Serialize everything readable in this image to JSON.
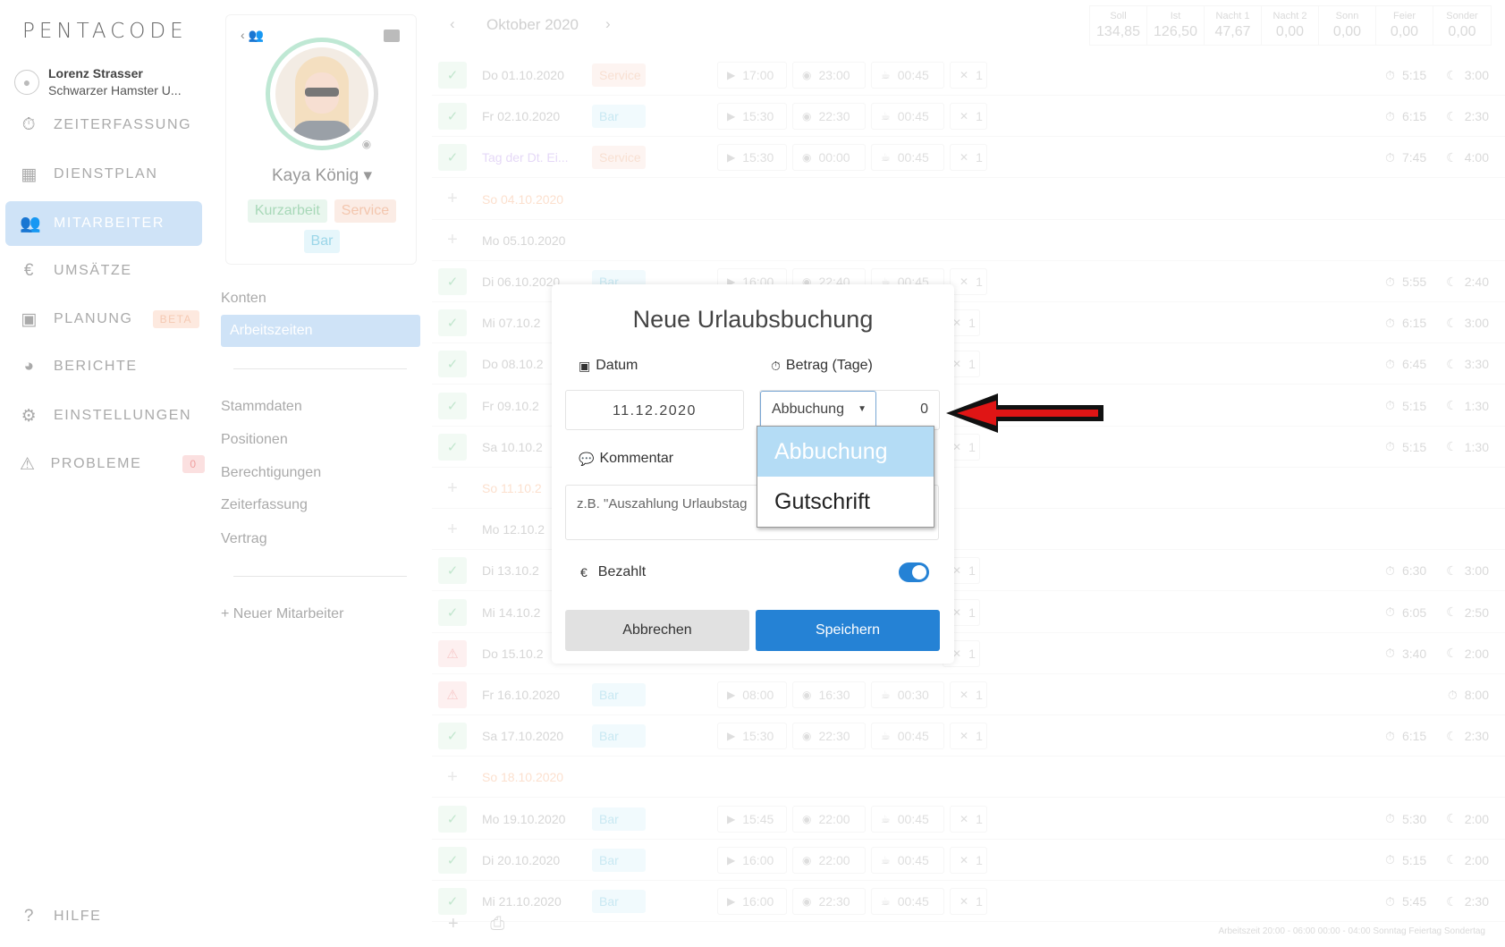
{
  "logo": "PENTACODE",
  "user": {
    "name": "Lorenz Strasser",
    "company": "Schwarzer Hamster U..."
  },
  "nav": {
    "items": [
      {
        "label": "ZEITERFASSUNG"
      },
      {
        "label": "DIENSTPLAN"
      },
      {
        "label": "MITARBEITER"
      },
      {
        "label": "UMSÄTZE"
      },
      {
        "label": "PLANUNG",
        "badge": "BETA"
      },
      {
        "label": "BERICHTE"
      },
      {
        "label": "EINSTELLUNGEN"
      },
      {
        "label": "PROBLEME",
        "count": "0"
      }
    ],
    "help": "HILFE"
  },
  "profile": {
    "name": "Kaya König",
    "tags": [
      "Kurzarbeit",
      "Service",
      "Bar"
    ]
  },
  "submenu": {
    "items": [
      "Konten",
      "Arbeitszeiten"
    ],
    "items2": [
      "Stammdaten",
      "Positionen",
      "Berechtigungen",
      "Zeiterfassung",
      "Vertrag"
    ],
    "new_employee": "Neuer Mitarbeiter"
  },
  "calendar": {
    "month": "Oktober 2020",
    "stats": [
      {
        "k": "Soll",
        "v": "134,85"
      },
      {
        "k": "Ist",
        "v": "126,50"
      },
      {
        "k": "Nacht 1",
        "v": "47,67"
      },
      {
        "k": "Nacht 2",
        "v": "0,00"
      },
      {
        "k": "Sonn",
        "v": "0,00"
      },
      {
        "k": "Feier",
        "v": "0,00"
      },
      {
        "k": "Sonder",
        "v": "0,00"
      }
    ],
    "rows": [
      {
        "date": "Do 01.10.2020",
        "pos": "Service",
        "start": "17:00",
        "end": "23:00",
        "pause": "00:45",
        "meal": "1",
        "work": "5:15",
        "night": "3:00"
      },
      {
        "date": "Fr 02.10.2020",
        "pos": "Bar",
        "start": "15:30",
        "end": "22:30",
        "pause": "00:45",
        "meal": "1",
        "work": "6:15",
        "night": "2:30"
      },
      {
        "date": "Tag der Dt. Ei...",
        "pos": "Service",
        "start": "15:30",
        "end": "00:00",
        "pause": "00:45",
        "meal": "1",
        "work": "7:45",
        "night": "4:00"
      },
      {
        "date": "So 04.10.2020"
      },
      {
        "date": "Mo 05.10.2020"
      },
      {
        "date": "Di 06.10.2020",
        "pos": "Bar",
        "start": "16:00",
        "end": "22:40",
        "pause": "00:45",
        "meal": "1",
        "work": "5:55",
        "night": "2:40"
      },
      {
        "date": "Mi 07.10.2",
        "meal": "1",
        "work": "6:15",
        "night": "3:00"
      },
      {
        "date": "Do 08.10.2",
        "meal": "1",
        "work": "6:45",
        "night": "3:30"
      },
      {
        "date": "Fr 09.10.2",
        "work": "5:15",
        "night": "1:30"
      },
      {
        "date": "Sa 10.10.2",
        "meal": "1",
        "work": "5:15",
        "night": "1:30"
      },
      {
        "date": "So 11.10.2"
      },
      {
        "date": "Mo 12.10.2"
      },
      {
        "date": "Di 13.10.2",
        "meal": "1",
        "work": "6:30",
        "night": "3:00"
      },
      {
        "date": "Mi 14.10.2",
        "meal": "1",
        "work": "6:05",
        "night": "2:50"
      },
      {
        "date": "Do 15.10.2",
        "meal": "1",
        "work": "3:40",
        "night": "2:00"
      },
      {
        "date": "Fr 16.10.2020",
        "pos": "Bar",
        "start": "08:00",
        "end": "16:30",
        "pause": "00:30",
        "meal": "1",
        "work": "8:00"
      },
      {
        "date": "Sa 17.10.2020",
        "pos": "Bar",
        "start": "15:30",
        "end": "22:30",
        "pause": "00:45",
        "meal": "1",
        "work": "6:15",
        "night": "2:30"
      },
      {
        "date": "So 18.10.2020"
      },
      {
        "date": "Mo 19.10.2020",
        "pos": "Bar",
        "start": "15:45",
        "end": "22:00",
        "pause": "00:45",
        "meal": "1",
        "work": "5:30",
        "night": "2:00"
      },
      {
        "date": "Di 20.10.2020",
        "pos": "Bar",
        "start": "16:00",
        "end": "22:00",
        "pause": "00:45",
        "meal": "1",
        "work": "5:15",
        "night": "2:00"
      },
      {
        "date": "Mi 21.10.2020",
        "pos": "Bar",
        "start": "16:00",
        "end": "22:30",
        "pause": "00:45",
        "meal": "1",
        "work": "5:45",
        "night": "2:30"
      }
    ],
    "legend": "Arbeitszeit  20:00 - 06:00  00:00 - 04:00  Sonntag  Feiertag  Sondertag"
  },
  "modal": {
    "title": "Neue Urlaubsbuchung",
    "date_label": "Datum",
    "date_value": "11.12.2020",
    "amount_label": "Betrag (Tage)",
    "type_selected": "Abbuchung",
    "amount_value": "0",
    "options": [
      "Abbuchung",
      "Gutschrift"
    ],
    "comment_label": "Kommentar",
    "comment_placeholder": "z.B. \"Auszahlung Urlaubstag",
    "paid_label": "Bezahlt",
    "paid": true,
    "cancel": "Abbrechen",
    "save": "Speichern"
  },
  "colors": {
    "primary": "#2582d5",
    "arrow": "#e01515",
    "active_nav": "#cfe3f7"
  }
}
